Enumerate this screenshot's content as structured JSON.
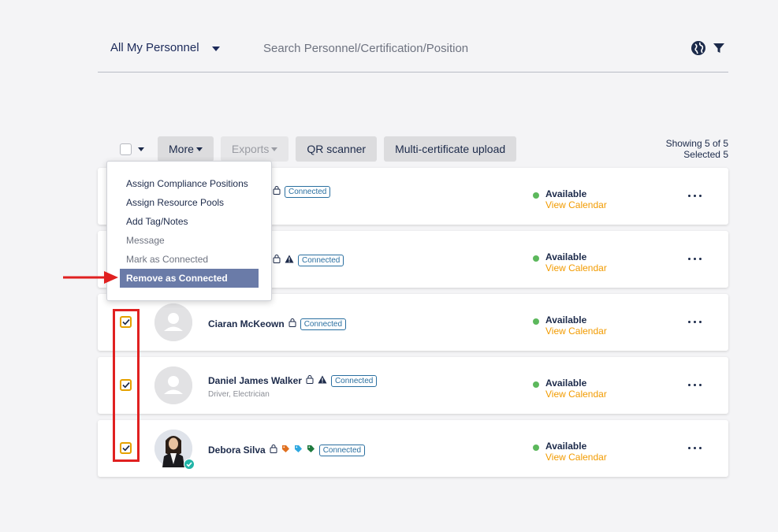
{
  "header": {
    "scope_label": "All My Personnel",
    "search_placeholder": "Search Personnel/Certification/Position"
  },
  "toolbar": {
    "more_label": "More",
    "exports_label": "Exports",
    "qr_label": "QR scanner",
    "multi_cert_label": "Multi-certificate upload",
    "showing": "Showing 5 of 5",
    "selected": "Selected 5"
  },
  "menu": {
    "items": [
      "Assign Compliance Positions",
      "Assign Resource Pools",
      "Add Tag/Notes",
      "Message",
      "Mark as Connected",
      "Remove as Connected"
    ]
  },
  "rows": [
    {
      "name": "",
      "badge": "Connected",
      "status": "Available",
      "calendar": "View Calendar"
    },
    {
      "name": "",
      "badge": "Connected",
      "status": "Available",
      "calendar": "View Calendar"
    },
    {
      "name": "Ciaran McKeown",
      "badge": "Connected",
      "status": "Available",
      "calendar": "View Calendar"
    },
    {
      "name": "Daniel James Walker",
      "positions": "Driver, Electrician",
      "badge": "Connected",
      "status": "Available",
      "calendar": "View Calendar"
    },
    {
      "name": "Debora Silva",
      "badge": "Connected",
      "status": "Available",
      "calendar": "View Calendar"
    }
  ],
  "colors": {
    "accent_orange": "#f29b00",
    "available_green": "#5cb85c",
    "menu_active": "#6a7ba8",
    "annotation_red": "#e02020"
  }
}
